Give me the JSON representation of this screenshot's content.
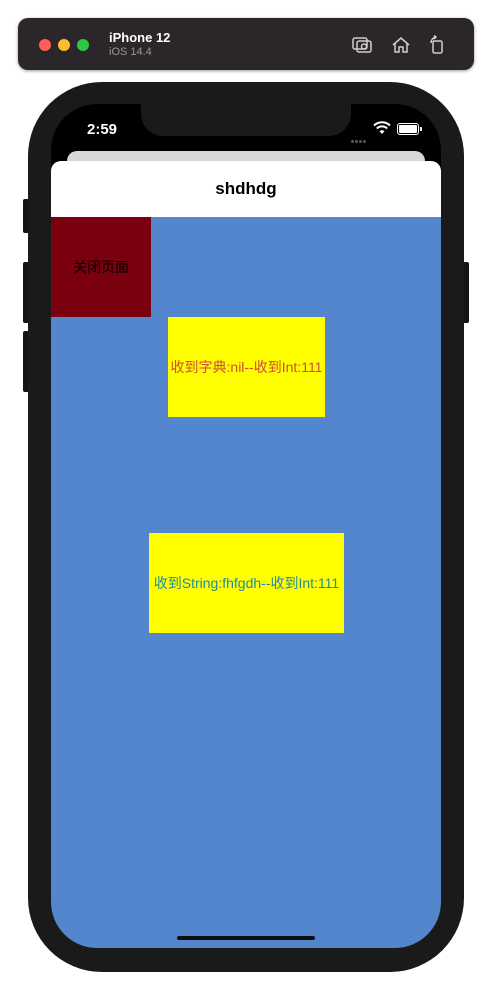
{
  "simulator": {
    "device_name": "iPhone 12",
    "os_version": "iOS 14.4",
    "icons": [
      "screenshot-icon",
      "home-icon",
      "rotate-icon"
    ]
  },
  "status_bar": {
    "time": "2:59",
    "icons": [
      "cellular-dots-icon",
      "wifi-icon",
      "battery-icon"
    ]
  },
  "nav": {
    "title": "shdhdg"
  },
  "buttons": {
    "close_page": "关闭页面"
  },
  "labels": {
    "dict_result": "收到字典:nil--收到Int:111",
    "string_result": "收到String:fhfgdh--收到Int:111"
  },
  "colors": {
    "background": "#5486ce",
    "close_button": "#7a0010",
    "label_background": "#ffff00",
    "dict_text": "#d24a3a",
    "string_text": "#1f8d9b"
  }
}
